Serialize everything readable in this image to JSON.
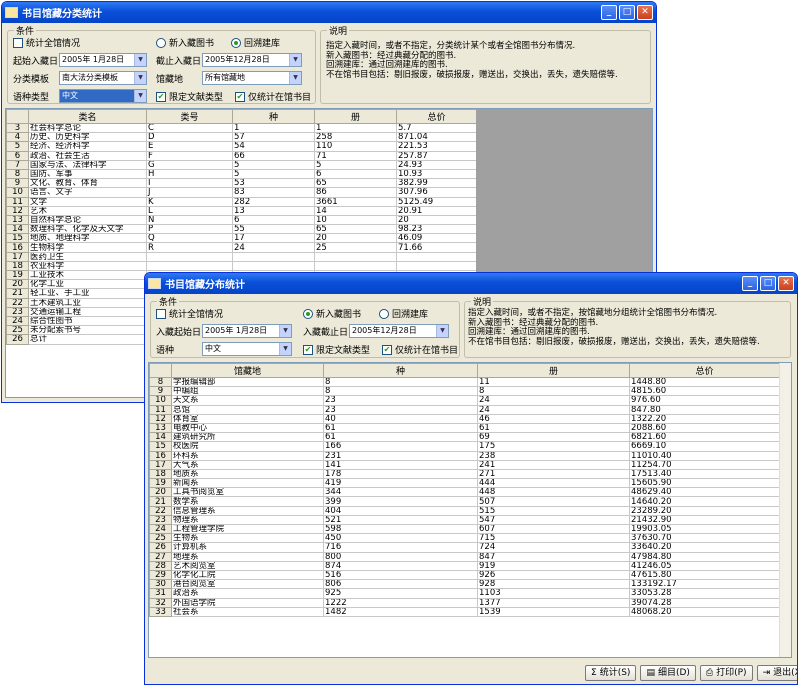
{
  "win1": {
    "title": "书目馆藏分类统计",
    "group_cond": "条件",
    "chk_all": "统计全馆情况",
    "radio_new": "新入藏图书",
    "radio_return": "回溯建库",
    "start_label": "起始入藏日",
    "start_value": "2005年 1月28日",
    "end_label": "截止入藏日",
    "end_value": "2005年12月28日",
    "template_label": "分类模板",
    "template_value": "南大法分类模板",
    "loc_label": "馆藏地",
    "loc_value": "所有馆藏地",
    "lang_label": "语种类型",
    "lang_value": "中文",
    "chk_doc": "限定文献类型",
    "chk_only": "仅统计在馆书目",
    "group_desc": "说明",
    "desc": "指定入藏时间，或者不指定，分类统计某个或者全馆图书分布情况.\n新入藏图书：经过典藏分配的图书.\n回溯建库：通过回溯建库的图书.\n不在馆书目包括：剔旧报废，破损报废，赠送出，交换出，丢失，遗失赔偿等.",
    "headers": [
      "类名",
      "类号",
      "种",
      "册",
      "总价"
    ],
    "rows": [
      [
        "3",
        "社会科学总论",
        "C",
        "1",
        "1",
        "5.7"
      ],
      [
        "4",
        "历史、历史科学",
        "D",
        "57",
        "258",
        "871.04"
      ],
      [
        "5",
        "经济、经济科学",
        "E",
        "54",
        "110",
        "221.53"
      ],
      [
        "6",
        "政治、社会生活",
        "F",
        "66",
        "71",
        "257.87"
      ],
      [
        "7",
        "国家与法、法律科学",
        "G",
        "5",
        "5",
        "24.93"
      ],
      [
        "8",
        "国防、军事",
        "H",
        "5",
        "6",
        "10.93"
      ],
      [
        "9",
        "文化、教育、体育",
        "I",
        "53",
        "65",
        "382.99"
      ],
      [
        "10",
        "语言、文字",
        "J",
        "83",
        "86",
        "307.96"
      ],
      [
        "11",
        "文学",
        "K",
        "282",
        "3661",
        "5125.49"
      ],
      [
        "12",
        "艺术",
        "L",
        "13",
        "14",
        "20.91"
      ],
      [
        "13",
        "自然科学总论",
        "N",
        "6",
        "10",
        "20"
      ],
      [
        "14",
        "数理科学、化学及天文学",
        "P",
        "55",
        "65",
        "98.23"
      ],
      [
        "15",
        "地质、地理科学",
        "Q",
        "17",
        "20",
        "46.09"
      ],
      [
        "16",
        "生物科学",
        "R",
        "24",
        "25",
        "71.66"
      ],
      [
        "17",
        "医药卫生",
        "",
        "",
        "",
        ""
      ],
      [
        "18",
        "农业科学",
        "",
        "",
        "",
        ""
      ],
      [
        "19",
        "工业技术",
        "",
        "",
        "",
        ""
      ],
      [
        "20",
        "化学工业",
        "",
        "",
        "",
        ""
      ],
      [
        "21",
        "轻工业、手工业",
        "",
        "",
        "",
        ""
      ],
      [
        "22",
        "土木建筑工业",
        "",
        "",
        "",
        ""
      ],
      [
        "23",
        "交通运输工程",
        "",
        "",
        "",
        ""
      ],
      [
        "24",
        "综合性图书",
        "",
        "",
        "",
        ""
      ],
      [
        "25",
        "未分配索书号",
        "",
        "",
        "",
        ""
      ],
      [
        "26",
        "总计",
        "",
        "",
        "",
        ""
      ]
    ]
  },
  "win2": {
    "title": "书目馆藏分布统计",
    "group_cond": "条件",
    "chk_all": "统计全馆情况",
    "radio_new": "新入藏图书",
    "radio_return": "回溯建库",
    "start_label": "入藏起始日",
    "start_value": "2005年 1月28日",
    "end_label": "入藏截止日",
    "end_value": "2005年12月28日",
    "lang_label": "语种",
    "lang_value": "中文",
    "chk_doc": "限定文献类型",
    "chk_only": "仅统计在馆书目",
    "group_desc": "说明",
    "desc": "指定入藏时间，或者不指定，按馆藏地分组统计全馆图书分布情况.\n新入藏图书：经过典藏分配的图书.\n回溯建库：通过回溯建库的图书.\n不在馆书目包括：剔旧报废，破损报废，赠送出，交换出，丢失，遗失赔偿等.",
    "headers": [
      "馆藏地",
      "种",
      "册",
      "总价"
    ],
    "rows": [
      [
        "8",
        "学报编辑部",
        "8",
        "11",
        "1448.80"
      ],
      [
        "9",
        "中编组",
        "8",
        "8",
        "4815.60"
      ],
      [
        "10",
        "天文系",
        "23",
        "24",
        "976.60"
      ],
      [
        "11",
        "总馆",
        "23",
        "24",
        "847.80"
      ],
      [
        "12",
        "体育室",
        "40",
        "46",
        "1322.20"
      ],
      [
        "13",
        "电教中心",
        "61",
        "61",
        "2088.60"
      ],
      [
        "14",
        "建筑研究所",
        "61",
        "69",
        "6821.60"
      ],
      [
        "15",
        "校医院",
        "166",
        "175",
        "6669.10"
      ],
      [
        "16",
        "环科系",
        "231",
        "238",
        "11010.40"
      ],
      [
        "17",
        "大气系",
        "141",
        "241",
        "11254.70"
      ],
      [
        "18",
        "地质系",
        "178",
        "271",
        "17513.40"
      ],
      [
        "19",
        "新闻系",
        "419",
        "444",
        "15605.90"
      ],
      [
        "20",
        "工具书阅览室",
        "344",
        "448",
        "48629.40"
      ],
      [
        "21",
        "数学系",
        "399",
        "507",
        "14640.20"
      ],
      [
        "22",
        "信息管理系",
        "404",
        "515",
        "23289.20"
      ],
      [
        "23",
        "物理系",
        "521",
        "547",
        "21432.90"
      ],
      [
        "24",
        "工程管理学院",
        "598",
        "607",
        "19903.05"
      ],
      [
        "25",
        "生物系",
        "450",
        "715",
        "37630.70"
      ],
      [
        "26",
        "计算机系",
        "716",
        "724",
        "33640.20"
      ],
      [
        "27",
        "地理系",
        "800",
        "847",
        "47984.80"
      ],
      [
        "28",
        "艺术阅览室",
        "874",
        "919",
        "41246.05"
      ],
      [
        "29",
        "化学化工院",
        "516",
        "926",
        "47615.80"
      ],
      [
        "30",
        "港台阅览室",
        "806",
        "928",
        "133192.17"
      ],
      [
        "31",
        "政治系",
        "925",
        "1103",
        "33053.28"
      ],
      [
        "32",
        "外国语学院",
        "1222",
        "1377",
        "39074.28"
      ],
      [
        "33",
        "社会系",
        "1482",
        "1539",
        "48068.20"
      ]
    ],
    "btn_stat": "统计(S)",
    "btn_detail": "细目(D)",
    "btn_print": "打印(P)",
    "btn_exit": "退出(X)"
  }
}
